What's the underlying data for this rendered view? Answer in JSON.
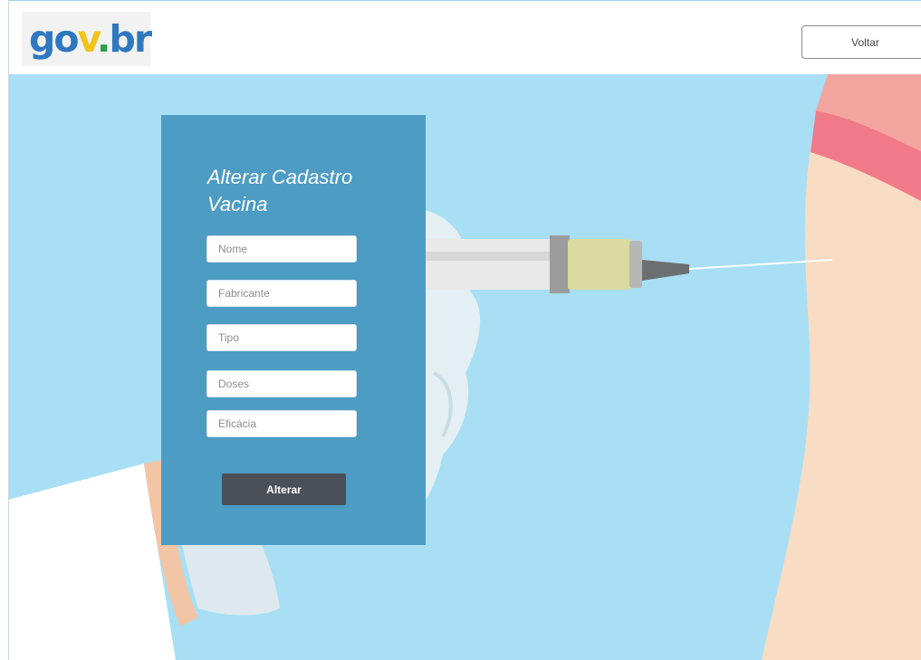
{
  "header": {
    "logo": {
      "parts": [
        "go",
        "v",
        ".",
        "br"
      ],
      "colors": [
        "#2f78bf",
        "#f2c318",
        "#2aa04a",
        "#2f78bf"
      ]
    },
    "back_label": "Voltar"
  },
  "form": {
    "title_line1": "Alterar Cadastro",
    "title_line2": "Vacina",
    "fields": [
      {
        "placeholder": "Nome",
        "value": ""
      },
      {
        "placeholder": "Fabricante",
        "value": ""
      },
      {
        "placeholder": "Tipo",
        "value": ""
      },
      {
        "placeholder": "Doses",
        "value": ""
      },
      {
        "placeholder": "Eficácia",
        "value": ""
      }
    ],
    "submit_label": "Alterar"
  },
  "theme": {
    "hero_bg": "#a8dff5",
    "card_bg": "#4c9cc4",
    "button_bg": "#4b5057"
  }
}
